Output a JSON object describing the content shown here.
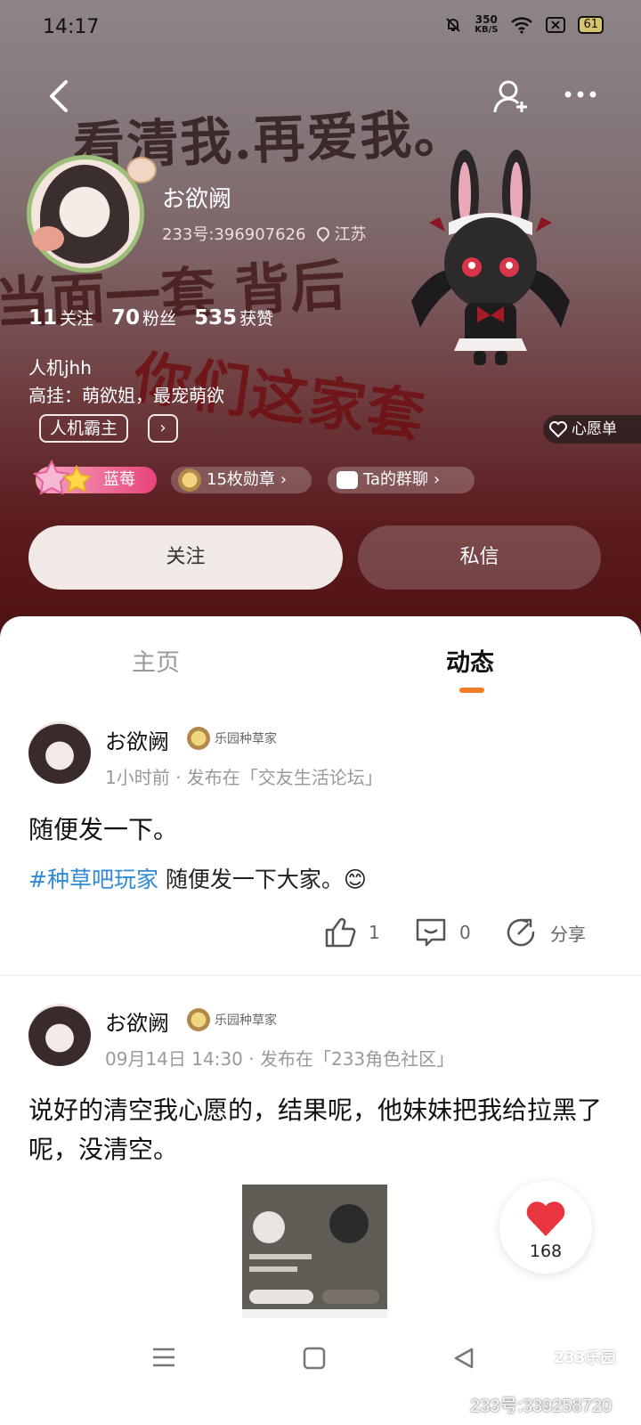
{
  "status_bar": {
    "time": "14:17",
    "net_speed_value": "350",
    "net_speed_unit": "KB/S",
    "battery": "61"
  },
  "background_text": {
    "line1": "看清我.再爱我。",
    "line2": "当面一套 背后",
    "line3": "你们这家套"
  },
  "profile": {
    "nickname": "お欲阙",
    "id_text": "233号:396907626",
    "location": "江苏",
    "following_count": "11",
    "following_label": "关注",
    "fans_count": "70",
    "fans_label": "粉丝",
    "likes_count": "535",
    "likes_label": "获赞",
    "bio_line1": "人机jhh",
    "bio_line2": "高挂：萌欲姐，最宠萌欲",
    "tag": "人机霸主",
    "wishlist": "心愿单",
    "level_label": "蓝莓",
    "medals": "15枚勋章",
    "group_chat": "Ta的群聊"
  },
  "buttons": {
    "follow": "关注",
    "message": "私信"
  },
  "tabs": {
    "home": "主页",
    "feed": "动态"
  },
  "posts": [
    {
      "author": "お欲阙",
      "badge": "乐园种草家",
      "meta": "1小时前 · 发布在「交友生活论坛」",
      "text": "随便发一下。",
      "hashtag": "#种草吧玩家",
      "subtext": " 随便发一下大家。😊",
      "likes": "1",
      "comments": "0",
      "share": "分享"
    },
    {
      "author": "お欲阙",
      "badge": "乐园种草家",
      "meta": "09月14日 14:30 · 发布在「233角色社区」",
      "text": "说好的清空我心愿的，结果呢，他妹妹把我给拉黑了呢，没清空。"
    }
  ],
  "floating_like": {
    "count": "168"
  },
  "watermark": {
    "logo": "233乐园",
    "text": "233号:339258720"
  },
  "colors": {
    "accent": "#f07d25",
    "hashtag": "#2f8bd6",
    "like_heart": "#e8353f",
    "level_chip": "#e9437a"
  }
}
